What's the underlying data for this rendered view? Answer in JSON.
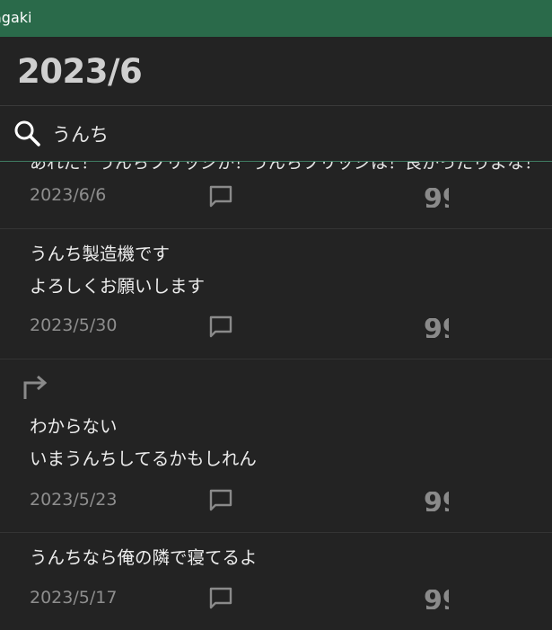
{
  "app": {
    "title_fragment": "agaki",
    "accent": "#2a6a4a"
  },
  "header": {
    "month": "2023/6"
  },
  "search": {
    "value": "うんち",
    "icon": "search-icon"
  },
  "posts": [
    {
      "text_lines": [
        "あれだ！うんちブリッジか！うんちブリッジは！良かったりよな！"
      ],
      "date": "2023/6/6",
      "partial": true
    },
    {
      "text_lines": [
        "うんち製造機です",
        "よろしくお願いします"
      ],
      "date": "2023/5/30"
    },
    {
      "repost": true,
      "text_lines": [
        "わからない",
        "いまうんちしてるかもしれん"
      ],
      "date": "2023/5/23"
    },
    {
      "text_lines": [
        "うんちなら俺の隣で寝てるよ"
      ],
      "date": "2023/5/17"
    }
  ]
}
